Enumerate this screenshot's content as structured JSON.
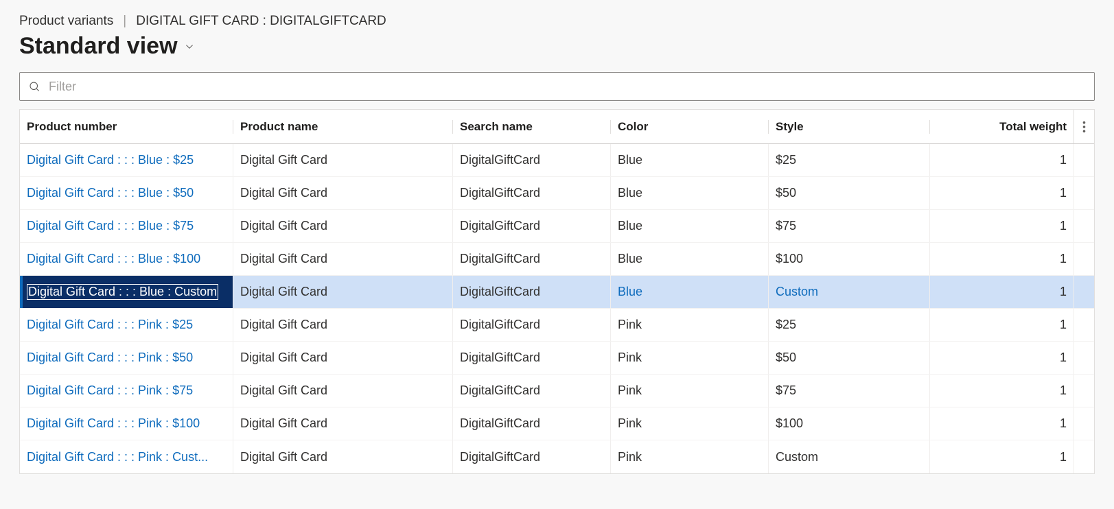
{
  "breadcrumb": {
    "module": "Product variants",
    "record": "DIGITAL GIFT CARD : DIGITALGIFTCARD"
  },
  "view": {
    "title": "Standard view"
  },
  "filter": {
    "placeholder": "Filter"
  },
  "columns": {
    "product_number": "Product number",
    "product_name": "Product name",
    "search_name": "Search name",
    "color": "Color",
    "style": "Style",
    "total_weight": "Total weight"
  },
  "rows": [
    {
      "product_number": "Digital Gift Card :  :  : Blue : $25",
      "product_name": "Digital Gift Card",
      "search_name": "DigitalGiftCard",
      "color": "Blue",
      "style": "$25",
      "total_weight": "1",
      "selected": false
    },
    {
      "product_number": "Digital Gift Card :  :  : Blue : $50",
      "product_name": "Digital Gift Card",
      "search_name": "DigitalGiftCard",
      "color": "Blue",
      "style": "$50",
      "total_weight": "1",
      "selected": false
    },
    {
      "product_number": "Digital Gift Card :  :  : Blue : $75",
      "product_name": "Digital Gift Card",
      "search_name": "DigitalGiftCard",
      "color": "Blue",
      "style": "$75",
      "total_weight": "1",
      "selected": false
    },
    {
      "product_number": "Digital Gift Card :  :  : Blue : $100",
      "product_name": "Digital Gift Card",
      "search_name": "DigitalGiftCard",
      "color": "Blue",
      "style": "$100",
      "total_weight": "1",
      "selected": false
    },
    {
      "product_number": "Digital Gift Card :  :  : Blue : Custom",
      "product_name": "Digital Gift Card",
      "search_name": "DigitalGiftCard",
      "color": "Blue",
      "style": "Custom",
      "total_weight": "1",
      "selected": true
    },
    {
      "product_number": "Digital Gift Card :  :  : Pink : $25",
      "product_name": "Digital Gift Card",
      "search_name": "DigitalGiftCard",
      "color": "Pink",
      "style": "$25",
      "total_weight": "1",
      "selected": false
    },
    {
      "product_number": "Digital Gift Card :  :  : Pink : $50",
      "product_name": "Digital Gift Card",
      "search_name": "DigitalGiftCard",
      "color": "Pink",
      "style": "$50",
      "total_weight": "1",
      "selected": false
    },
    {
      "product_number": "Digital Gift Card :  :  : Pink : $75",
      "product_name": "Digital Gift Card",
      "search_name": "DigitalGiftCard",
      "color": "Pink",
      "style": "$75",
      "total_weight": "1",
      "selected": false
    },
    {
      "product_number": "Digital Gift Card :  :  : Pink : $100",
      "product_name": "Digital Gift Card",
      "search_name": "DigitalGiftCard",
      "color": "Pink",
      "style": "$100",
      "total_weight": "1",
      "selected": false
    },
    {
      "product_number": "Digital Gift Card :  :  : Pink : Cust...",
      "product_name": "Digital Gift Card",
      "search_name": "DigitalGiftCard",
      "color": "Pink",
      "style": "Custom",
      "total_weight": "1",
      "selected": false
    }
  ]
}
